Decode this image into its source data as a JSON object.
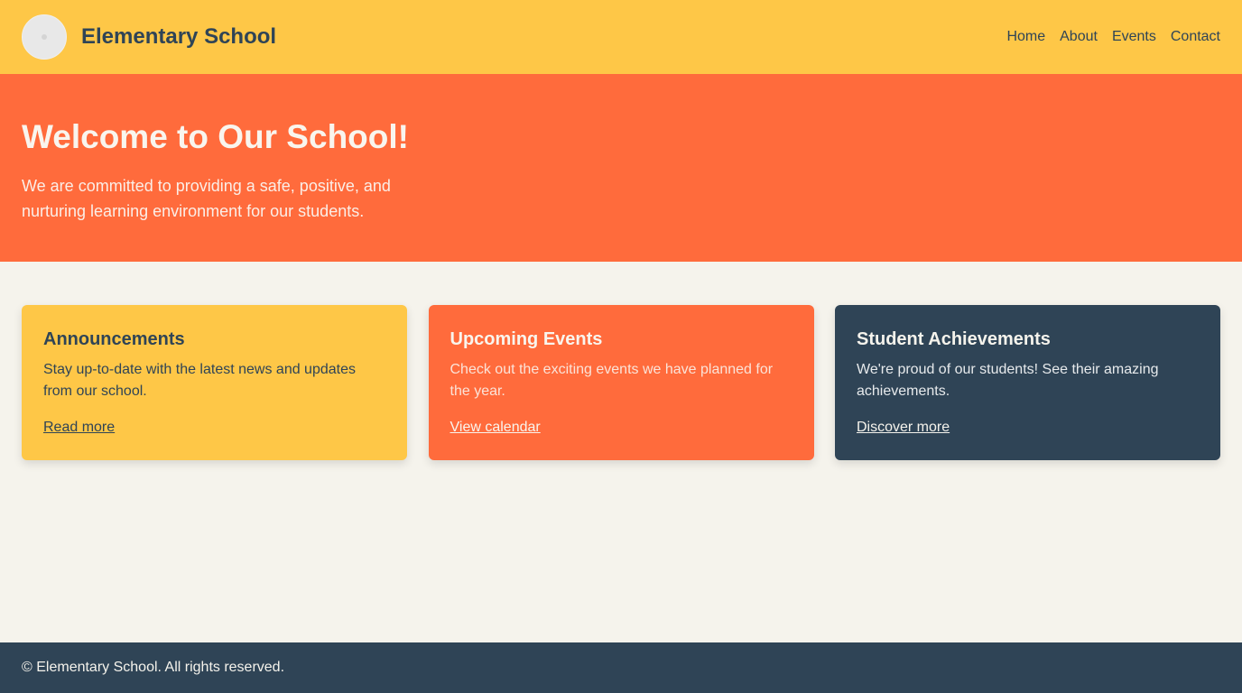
{
  "header": {
    "logo_icon": "school-logo-icon",
    "title": "Elementary School",
    "nav": [
      {
        "label": "Home"
      },
      {
        "label": "About"
      },
      {
        "label": "Events"
      },
      {
        "label": "Contact"
      }
    ]
  },
  "hero": {
    "title": "Welcome to Our School!",
    "text": "We are committed to providing a safe, positive, and nurturing learning environment for our students."
  },
  "cards": [
    {
      "title": "Announcements",
      "text": "Stay up-to-date with the latest news and updates from our school.",
      "link": "Read more"
    },
    {
      "title": "Upcoming Events",
      "text": "Check out the exciting events we have planned for the year.",
      "link": "View calendar"
    },
    {
      "title": "Student Achievements",
      "text": "We're proud of our students! See their amazing achievements.",
      "link": "Discover more"
    }
  ],
  "footer": {
    "text": "© Elementary School. All rights reserved."
  },
  "colors": {
    "yellow": "#fec747",
    "orange": "#ff6b3c",
    "navy": "#2f4456",
    "background": "#f5f3ec"
  }
}
